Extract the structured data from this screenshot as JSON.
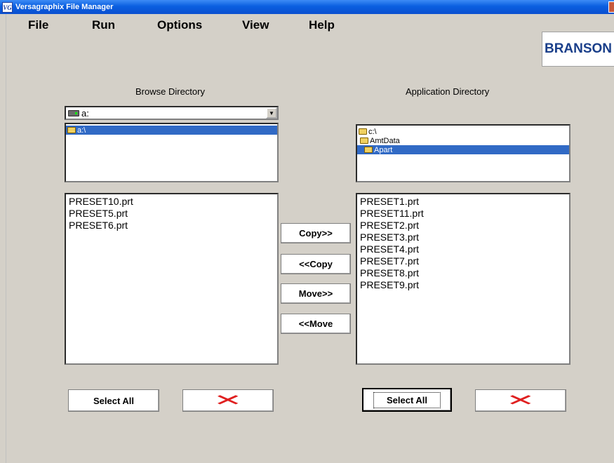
{
  "window": {
    "title": "Versagraphix File Manager",
    "icon_text": "VG"
  },
  "menu": [
    "File",
    "Run",
    "Options",
    "View",
    "Help"
  ],
  "logo": {
    "text": "BRANSON"
  },
  "browse": {
    "heading": "Browse Directory",
    "drive": "a:",
    "tree": [
      "a:\\"
    ],
    "files": [
      "PRESET10.prt",
      "PRESET5.prt",
      "PRESET6.prt"
    ],
    "select_all": "Select All"
  },
  "application": {
    "heading": "Application Directory",
    "tree": [
      "c:\\",
      "AmtData",
      "Apart"
    ],
    "files": [
      "PRESET1.prt",
      "PRESET11.prt",
      "PRESET2.prt",
      "PRESET3.prt",
      "PRESET4.prt",
      "PRESET7.prt",
      "PRESET8.prt",
      "PRESET9.prt"
    ],
    "select_all": "Select All"
  },
  "transfer": {
    "copy_right": "Copy>>",
    "copy_left": "<<Copy",
    "move_right": "Move>>",
    "move_left": "<<Move"
  },
  "icons": {
    "delete": "red-x-icon",
    "drive": "floppy-drive-icon",
    "folder": "folder-icon"
  },
  "colors": {
    "titlebar": "#0a5fe0",
    "selection": "#316ac5",
    "delete_x": "#e02020"
  }
}
